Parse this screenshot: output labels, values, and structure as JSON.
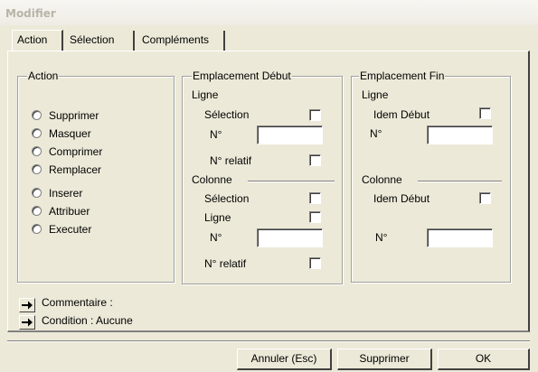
{
  "window": {
    "title": "Modifier"
  },
  "tabs": [
    {
      "label": "Action"
    },
    {
      "label": "Sélection"
    },
    {
      "label": "Compléments"
    }
  ],
  "action_group": {
    "legend": "Action",
    "options": [
      {
        "label": "Supprimer"
      },
      {
        "label": "Masquer"
      },
      {
        "label": "Comprimer"
      },
      {
        "label": "Remplacer"
      },
      {
        "label": "Inserer"
      },
      {
        "label": "Attribuer"
      },
      {
        "label": "Executer"
      }
    ]
  },
  "start_group": {
    "legend": "Emplacement Début",
    "ligne_title": "Ligne",
    "ligne_selection": "Sélection",
    "ligne_num": "N°",
    "ligne_relatif": "N° relatif",
    "colonne_title": "Colonne",
    "colonne_selection": "Sélection",
    "colonne_ligne": "Ligne",
    "colonne_num": "N°",
    "colonne_relatif": "N° relatif"
  },
  "end_group": {
    "legend": "Emplacement Fin",
    "ligne_title": "Ligne",
    "ligne_idem": "Idem Début",
    "ligne_num": "N°",
    "colonne_title": "Colonne",
    "colonne_idem": "Idem Début",
    "colonne_num": "N°"
  },
  "links": {
    "commentaire": "Commentaire :",
    "condition": "Condition : Aucune"
  },
  "buttons": {
    "annuler": "Annuler (Esc)",
    "supprimer": "Supprimer",
    "ok": "OK"
  },
  "icons": {
    "arrow": "right-arrow-icon"
  }
}
